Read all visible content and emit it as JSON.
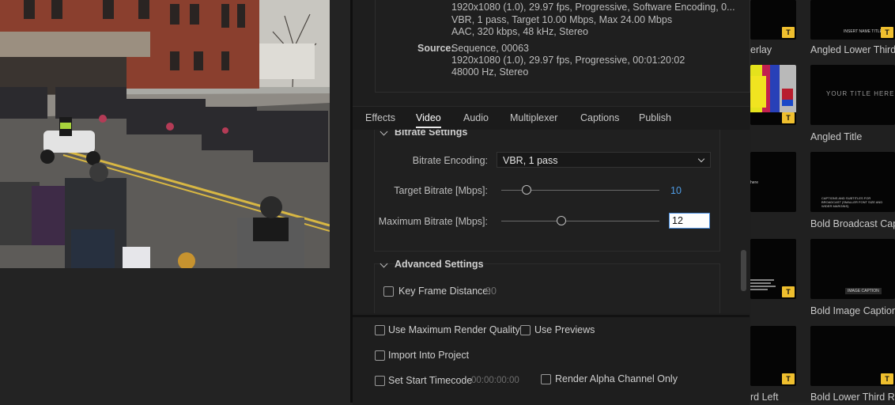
{
  "summary": {
    "output_lines": [
      "1920x1080 (1.0), 29.97 fps, Progressive, Software Encoding, 0...",
      "VBR, 1 pass, Target 10.00 Mbps, Max 24.00 Mbps",
      "AAC, 320 kbps, 48 kHz, Stereo"
    ],
    "source_label": "Source:",
    "source_lines": [
      "Sequence, 00063",
      "1920x1080 (1.0), 29.97 fps, Progressive, 00:01:20:02",
      "48000 Hz, Stereo"
    ]
  },
  "tabs": [
    {
      "label": "Effects"
    },
    {
      "label": "Video"
    },
    {
      "label": "Audio"
    },
    {
      "label": "Multiplexer"
    },
    {
      "label": "Captions"
    },
    {
      "label": "Publish"
    }
  ],
  "active_tab": "Video",
  "bitrate": {
    "section_title": "Bitrate Settings",
    "encoding_label": "Bitrate Encoding:",
    "encoding_value": "VBR, 1 pass",
    "target_label": "Target Bitrate [Mbps]:",
    "target_value": "10",
    "target_fraction": 0.16,
    "max_label": "Maximum Bitrate [Mbps]:",
    "max_value": "12",
    "max_fraction": 0.38
  },
  "advanced": {
    "section_title": "Advanced Settings",
    "keyframe_label": "Key Frame Distance:",
    "keyframe_value": "90"
  },
  "options": {
    "max_render_quality": "Use Maximum Render Quality",
    "use_previews": "Use Previews",
    "import_into_project": "Import Into Project",
    "set_start_timecode": "Set Start Timecode",
    "start_timecode_value": "00:00:00:00",
    "render_alpha": "Render Alpha Channel Only"
  },
  "templates": [
    {
      "label": "erlay",
      "badge": "T"
    },
    {
      "label": "Angled Lower Third",
      "badge": "T",
      "thumb_text": "INSERT NAME TITLE"
    },
    {
      "label": "",
      "badge": "T"
    },
    {
      "label": "Angled Title",
      "badge": "",
      "thumb_text": "YOUR TITLE HERE"
    },
    {
      "label": "",
      "badge": "",
      "thumb_text": "here"
    },
    {
      "label": "Bold Broadcast Capti",
      "badge": "",
      "thumb_text": "CAPTIONS AND SUBTITLES FOR BROADCAST (SMALLER FONT SIZE AND WIDER MARGINS)"
    },
    {
      "label": "",
      "badge": "T"
    },
    {
      "label": "Bold Image Caption",
      "badge": "",
      "thumb_text": "IMAGE CAPTION"
    },
    {
      "label": "rd Left",
      "badge": "T"
    },
    {
      "label": "Bold Lower Third Rig",
      "badge": "T"
    }
  ],
  "colors": {
    "accent_blue": "#4f9de6",
    "badge_yellow": "#efbf2e",
    "panel_bg": "#1f1f1f"
  }
}
